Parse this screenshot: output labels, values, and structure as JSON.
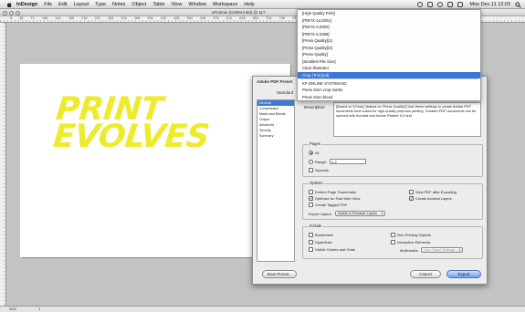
{
  "menubar": {
    "app": "InDesign",
    "items": [
      "File",
      "Edit",
      "Layout",
      "Type",
      "Notes",
      "Object",
      "Table",
      "View",
      "Window",
      "Workspace",
      "Help"
    ],
    "clock": "Mon Dec 11 12:03"
  },
  "window": {
    "title": "xPrintnie (InvBM.indd) @ 117"
  },
  "ruler": {
    "ticks": "0  36  72  108  144  180  216  252  288  324  360  396  432  468  504  540  576  612  648  684  720  756  792  828  864  900  936  972  1008  1044  1080  1116  1152  1188"
  },
  "statusbar": {
    "zoom": "25%",
    "page": "1"
  },
  "artwork": {
    "line1": "PRINT",
    "line2": "EVOLVES",
    "color": "#eeea2c"
  },
  "dialog": {
    "title": "Adobe PDF Preset",
    "standard_label": "Standard",
    "sidebar": [
      "General",
      "Compression",
      "Marks and Bleeds",
      "Output",
      "Advanced",
      "Security",
      "Summary"
    ],
    "description_label": "Description:",
    "description_text": "[Based on '[Clear]' [based on 'Press Quality']] Use these settings to create Adobe PDF documents best suited for high-quality prepress printing. Created PDF documents can be opened with Acrobat and Adobe Reader 5.0 and",
    "pages": {
      "title": "Pages",
      "all": "All",
      "range": "Range:",
      "range_value": "1-2",
      "spreads": "Spreads"
    },
    "options": {
      "title": "Options",
      "embed_thumbs": "Embed Page Thumbnails",
      "optimize": "Optimize for Fast Web View",
      "tagged": "Create Tagged PDF",
      "view_after": "View PDF after Exporting",
      "acrobat_layers": "Create Acrobat Layers",
      "export_layers_label": "Export Layers:",
      "export_layers_value": "Visible & Printable Layers"
    },
    "include": {
      "title": "Include",
      "bookmarks": "Bookmarks",
      "hyperlinks": "Hyperlinks",
      "guides": "Visible Guides and Grids",
      "nonprinting": "Non-Printing Objects",
      "interactive": "Interactive Elements",
      "multimedia_label": "Multimedia:",
      "multimedia_value": "Use Object Settings"
    },
    "buttons": {
      "save_preset": "Save Preset...",
      "cancel": "Cancel",
      "export": "Export"
    }
  },
  "preset_list": {
    "items": [
      "[High Quality Print]",
      "[PDF/X-1a:2001]",
      "[PDF/X-3:2002]",
      "[PDF/X-4:2008]",
      "[Press Quality](1)",
      "[Press Quality](2)",
      "[Press Quality]",
      "[Smallest File Size]",
      "Clear Illustrator",
      "Crop (Trim)(ed)",
      "KF-ONLINE SYSTEM BC",
      "Press 3mm crop marks",
      "Press 3mm bleed"
    ],
    "selected_index": 9
  }
}
